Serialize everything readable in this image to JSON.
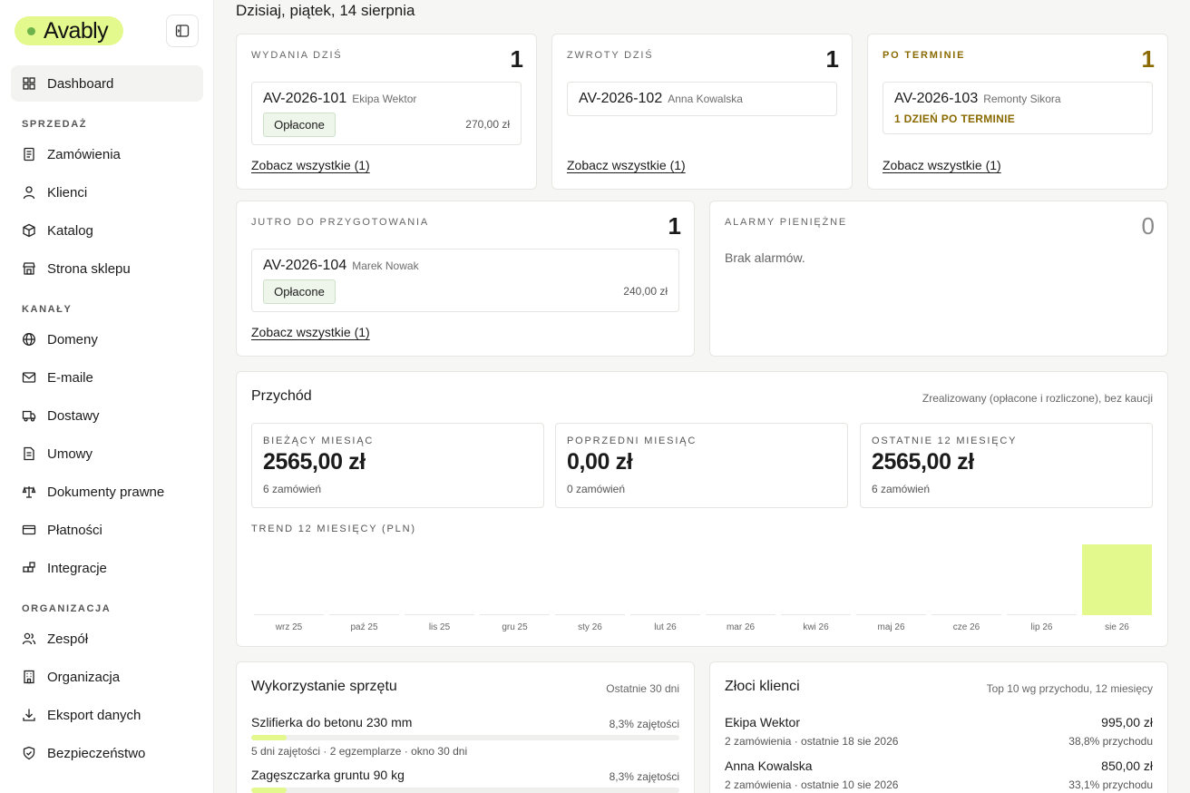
{
  "brand": {
    "name": "Avably",
    "accent": "#e3f88d"
  },
  "sidebar": {
    "dashboard": "Dashboard",
    "sections": {
      "sales": "SPRZEDAŻ",
      "channels": "KANAŁY",
      "organization": "ORGANIZACJA"
    },
    "items": {
      "orders": "Zamówienia",
      "clients": "Klienci",
      "catalog": "Katalog",
      "storefront": "Strona sklepu",
      "domains": "Domeny",
      "emails": "E-maile",
      "deliveries": "Dostawy",
      "contracts": "Umowy",
      "legal": "Dokumenty prawne",
      "payments": "Płatności",
      "integrations": "Integracje",
      "team": "Zespół",
      "org": "Organizacja",
      "export": "Eksport danych",
      "security": "Bezpieczeństwo"
    }
  },
  "header": {
    "date": "Dzisiaj, piątek, 14 sierpnia"
  },
  "cards": {
    "releases": {
      "label": "WYDANIA DZIŚ",
      "count": "1",
      "order_id": "AV-2026-101",
      "client": "Ekipa Wektor",
      "status": "Opłacone",
      "amount": "270,00 zł",
      "see_all": "Zobacz wszystkie (1)"
    },
    "returns": {
      "label": "ZWROTY DZIŚ",
      "count": "1",
      "order_id": "AV-2026-102",
      "client": "Anna Kowalska",
      "see_all": "Zobacz wszystkie (1)"
    },
    "overdue": {
      "label": "PO TERMINIE",
      "count": "1",
      "order_id": "AV-2026-103",
      "client": "Remonty Sikora",
      "overdue_text": "1 DZIEŃ PO TERMINIE",
      "see_all": "Zobacz wszystkie (1)"
    },
    "tomorrow": {
      "label": "JUTRO DO PRZYGOTOWANIA",
      "count": "1",
      "order_id": "AV-2026-104",
      "client": "Marek Nowak",
      "status": "Opłacone",
      "amount": "240,00 zł",
      "see_all": "Zobacz wszystkie (1)"
    },
    "alarms": {
      "label": "ALARMY PIENIĘŻNE",
      "count": "0",
      "empty": "Brak alarmów."
    }
  },
  "revenue": {
    "title": "Przychód",
    "note": "Zrealizowany (opłacone i rozliczone), bez kaucji",
    "kpis": [
      {
        "label": "BIEŻĄCY MIESIĄC",
        "value": "2565,00 zł",
        "sub": "6 zamówień"
      },
      {
        "label": "POPRZEDNI MIESIĄC",
        "value": "0,00 zł",
        "sub": "0 zamówień"
      },
      {
        "label": "OSTATNIE 12 MIESIĘCY",
        "value": "2565,00 zł",
        "sub": "6 zamówień"
      }
    ],
    "trend_label": "TREND 12 MIESIĘCY (PLN)"
  },
  "chart_data": {
    "type": "bar",
    "categories": [
      "wrz 25",
      "paź 25",
      "lis 25",
      "gru 25",
      "sty 26",
      "lut 26",
      "mar 26",
      "kwi 26",
      "maj 26",
      "cze 26",
      "lip 26",
      "sie 26"
    ],
    "values": [
      0,
      0,
      0,
      0,
      0,
      0,
      0,
      0,
      0,
      0,
      0,
      2565
    ],
    "title": "TREND 12 MIESIĘCY (PLN)",
    "bar_color": "#e3f88d",
    "grid": false
  },
  "equipment": {
    "title": "Wykorzystanie sprzętu",
    "note": "Ostatnie 30 dni",
    "items": [
      {
        "name": "Szlifierka do betonu 230 mm",
        "pct": "8,3% zajętości",
        "fill": 0.083,
        "meta": "5 dni zajętości · 2 egzemplarze · okno 30 dni"
      },
      {
        "name": "Zagęszczarka gruntu 90 kg",
        "pct": "8,3% zajętości",
        "fill": 0.083
      }
    ]
  },
  "gold_clients": {
    "title": "Złoci klienci",
    "note": "Top 10 wg przychodu, 12 miesięcy",
    "items": [
      {
        "name": "Ekipa Wektor",
        "meta": "2 zamówienia · ostatnie 18 sie 2026",
        "amount": "995,00 zł",
        "share": "38,8% przychodu"
      },
      {
        "name": "Anna Kowalska",
        "meta": "2 zamówienia · ostatnie 10 sie 2026",
        "amount": "850,00 zł",
        "share": "33,1% przychodu"
      }
    ]
  }
}
